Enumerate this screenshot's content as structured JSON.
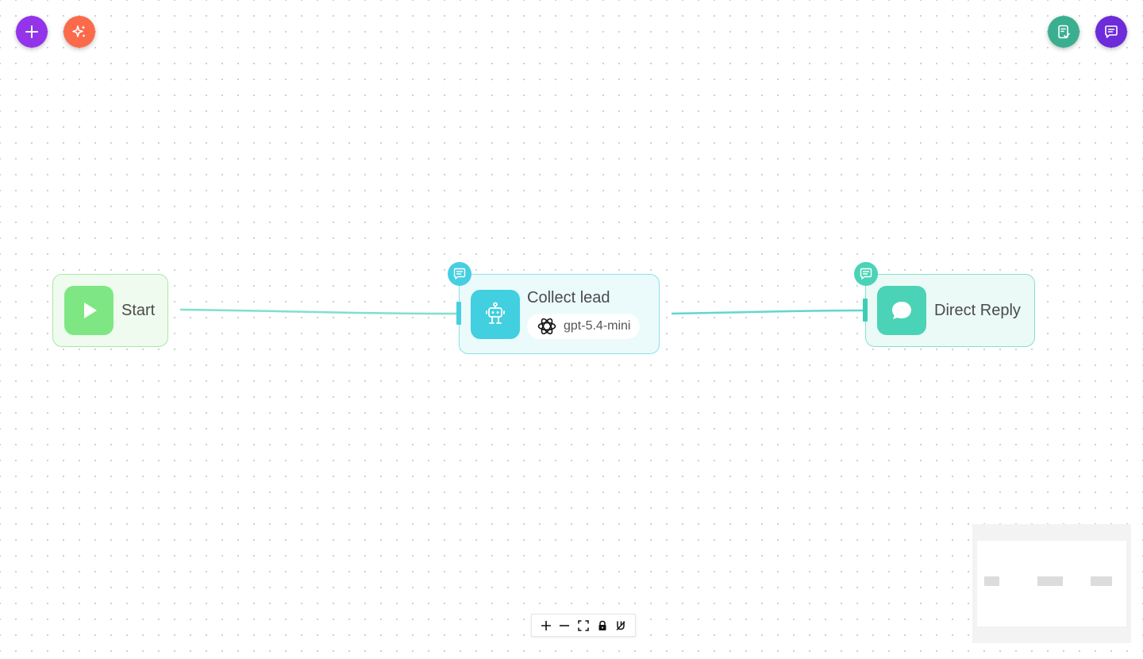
{
  "toolbar": {
    "add_icon": "plus-icon",
    "ai_icon": "sparkles-icon",
    "validate_icon": "clipboard-check-icon",
    "chat_icon": "chat-icon"
  },
  "nodes": {
    "start": {
      "label": "Start",
      "icon": "play-icon"
    },
    "agent": {
      "label": "Collect lead",
      "icon": "robot-icon",
      "model": "gpt-5.4-mini",
      "model_icon": "openai-logo-icon"
    },
    "reply": {
      "label": "Direct Reply",
      "icon": "message-bubble-icon"
    }
  },
  "controls": {
    "zoom_in_icon": "plus-icon",
    "zoom_out_icon": "minus-icon",
    "fit_view_icon": "fit-view-icon",
    "lock_icon": "lock-icon",
    "magnet_icon": "magnet-icon"
  },
  "colors": {
    "add": "#9333ea",
    "ai": "#fb6a4a",
    "validate": "#3aaf8f",
    "chat": "#6d2bd9",
    "start": "#7ee783",
    "agent": "#42cfe0",
    "reply": "#4ad3b6",
    "edge": "#7fe0cc"
  }
}
